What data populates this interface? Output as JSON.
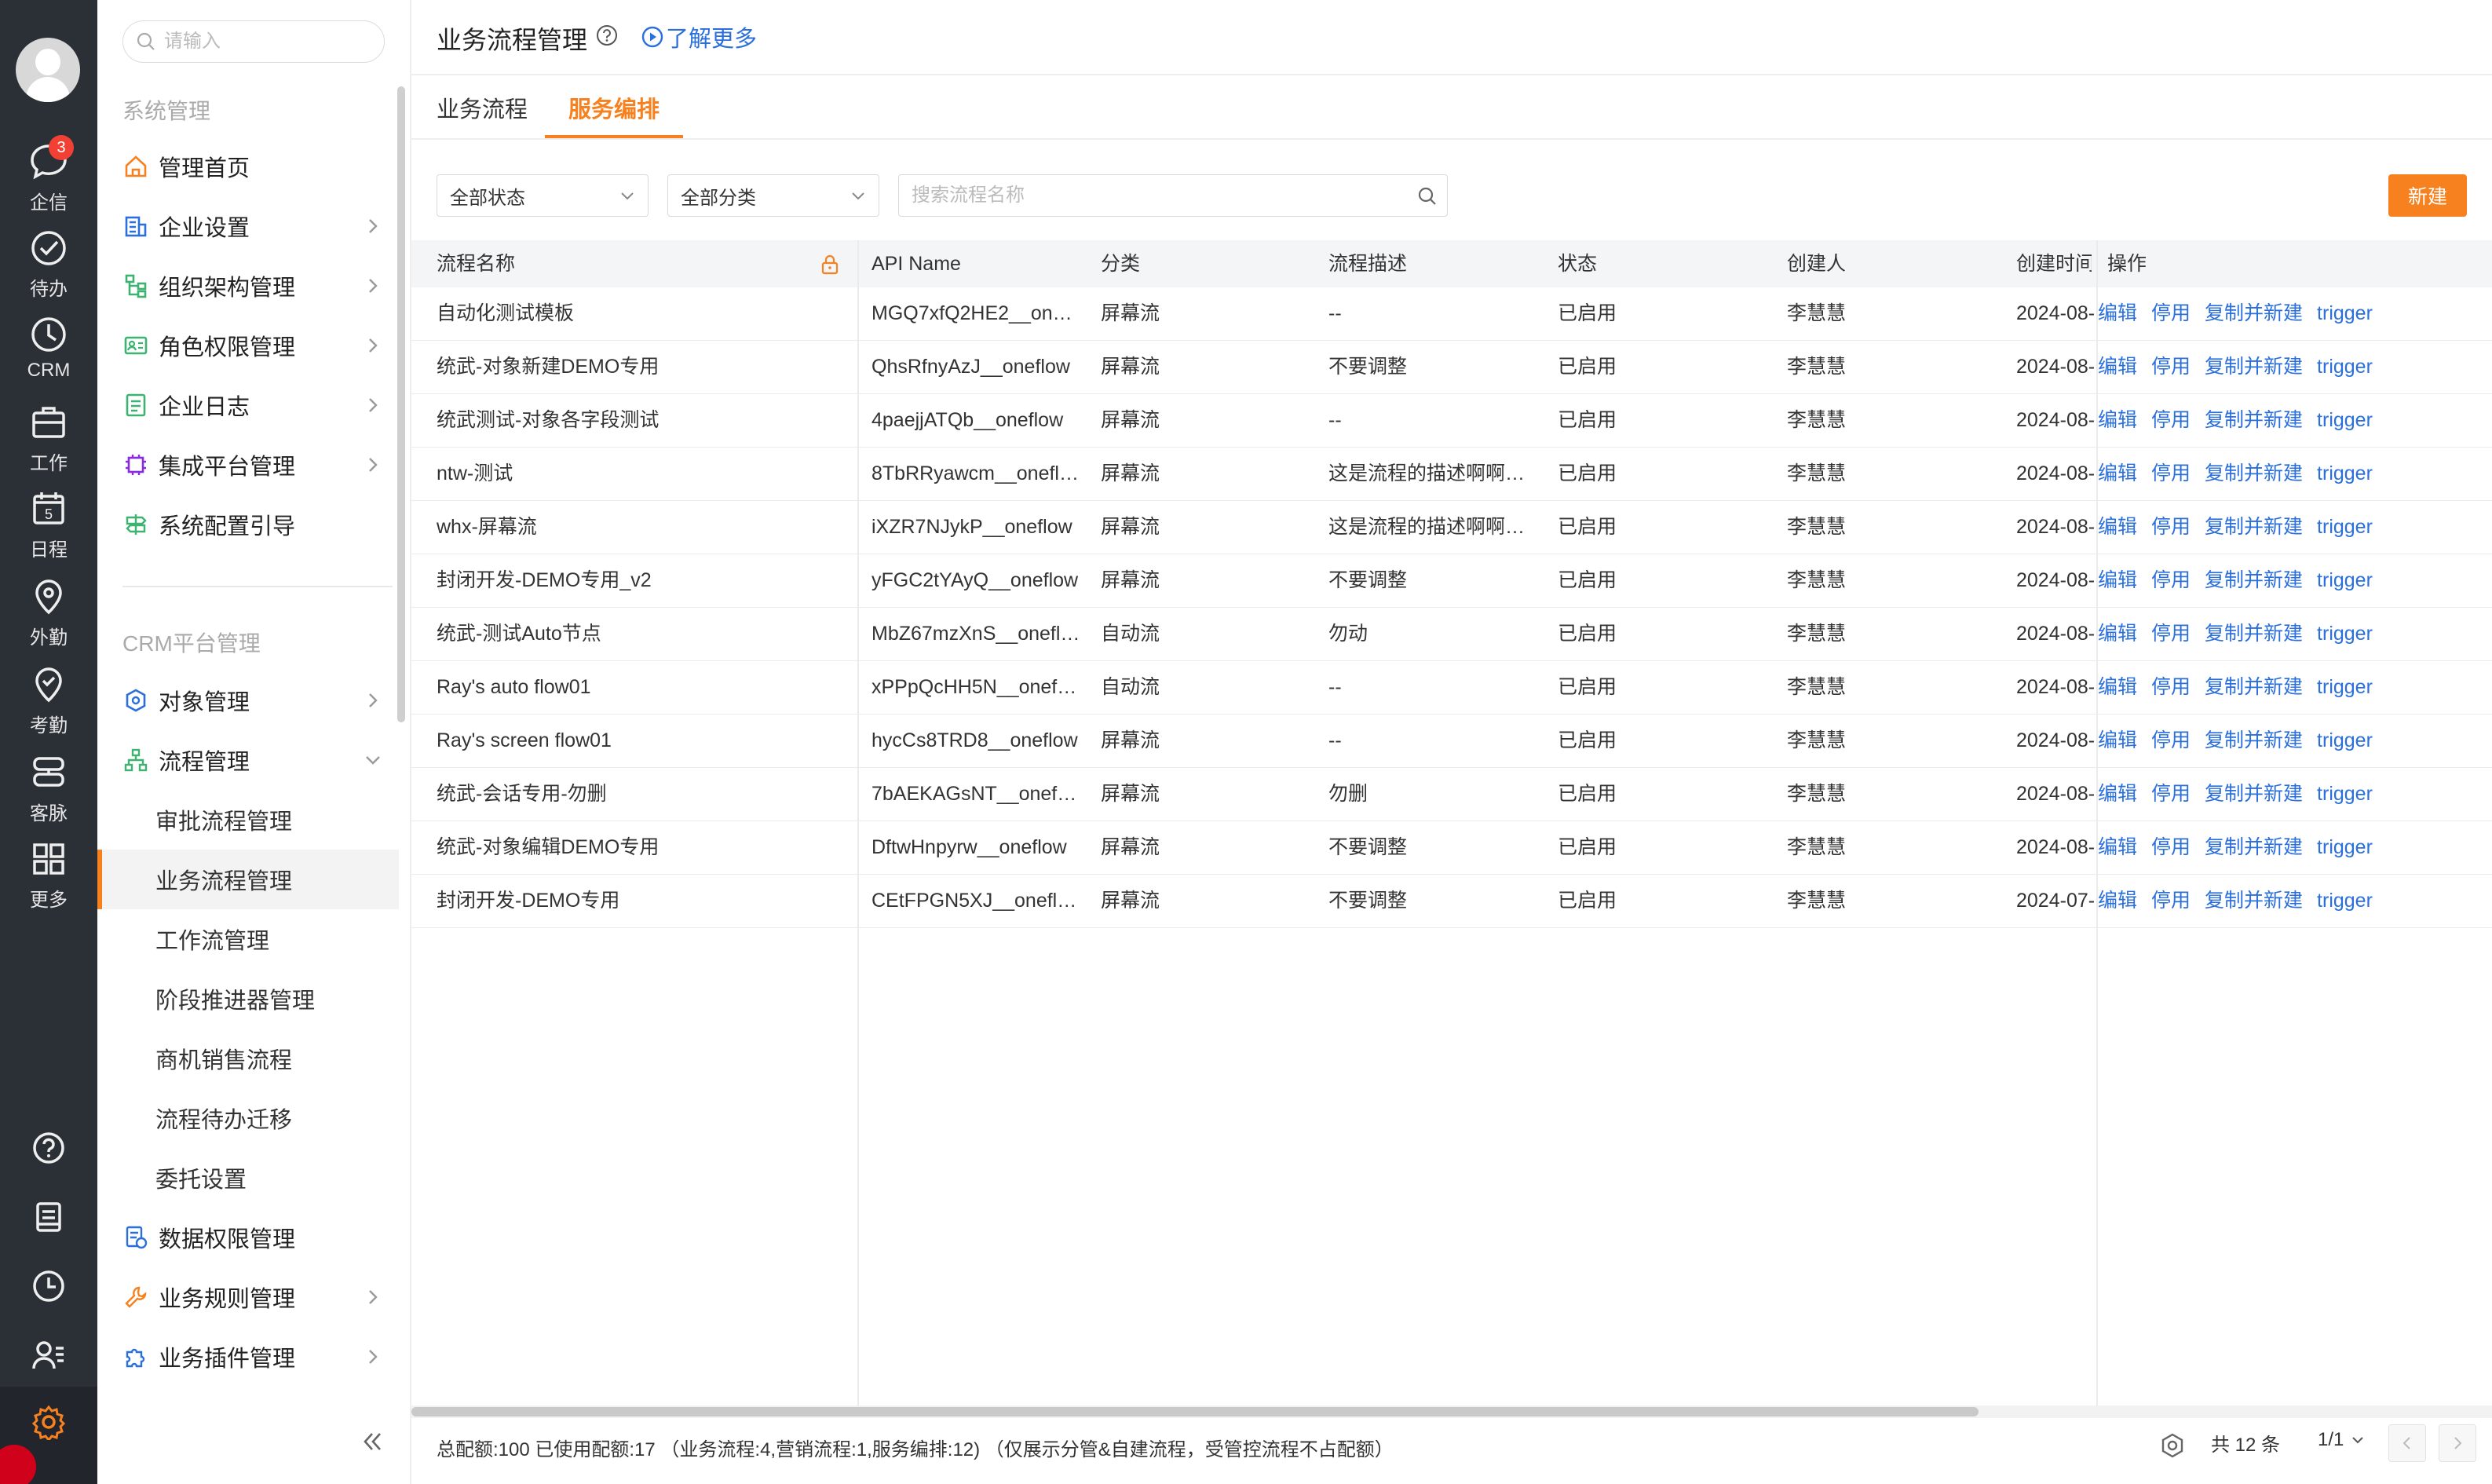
{
  "rail": {
    "items": [
      {
        "label": "企信",
        "icon": "chat-icon",
        "badge": "3"
      },
      {
        "label": "待办",
        "icon": "check-circle-icon"
      },
      {
        "label": "CRM",
        "icon": "clock-icon"
      },
      {
        "label": "工作",
        "icon": "briefcase-icon"
      },
      {
        "label": "日程",
        "icon": "calendar-icon",
        "day": "5"
      },
      {
        "label": "外勤",
        "icon": "location-icon"
      },
      {
        "label": "考勤",
        "icon": "attendance-icon"
      },
      {
        "label": "客脉",
        "icon": "contacts-icon"
      },
      {
        "label": "更多",
        "icon": "grid-icon"
      }
    ]
  },
  "sidebar": {
    "search_placeholder": "请输入",
    "section1": "系统管理",
    "items1": [
      {
        "label": "管理首页"
      },
      {
        "label": "企业设置"
      },
      {
        "label": "组织架构管理"
      },
      {
        "label": "角色权限管理"
      },
      {
        "label": "企业日志"
      },
      {
        "label": "集成平台管理"
      },
      {
        "label": "系统配置引导"
      }
    ],
    "section2": "CRM平台管理",
    "items2": [
      {
        "label": "对象管理"
      },
      {
        "label": "流程管理"
      }
    ],
    "sub_items": [
      {
        "label": "审批流程管理"
      },
      {
        "label": "业务流程管理"
      },
      {
        "label": "工作流管理"
      },
      {
        "label": "阶段推进器管理"
      },
      {
        "label": "商机销售流程"
      },
      {
        "label": "流程待办迁移"
      },
      {
        "label": "委托设置"
      }
    ],
    "items3": [
      {
        "label": "数据权限管理"
      },
      {
        "label": "业务规则管理"
      },
      {
        "label": "业务插件管理"
      }
    ]
  },
  "header": {
    "title": "业务流程管理",
    "learn_more": "了解更多"
  },
  "tabs": [
    {
      "label": "业务流程"
    },
    {
      "label": "服务编排"
    }
  ],
  "filters": {
    "status": "全部状态",
    "category": "全部分类",
    "search_placeholder": "搜索流程名称",
    "new_button": "新建"
  },
  "table": {
    "columns": [
      "流程名称",
      "API Name",
      "分类",
      "流程描述",
      "状态",
      "创建人",
      "创建时间",
      "操作"
    ],
    "rows": [
      {
        "name": "自动化测试模板",
        "api": "MGQ7xfQ2HE2__on…",
        "category": "屏幕流",
        "desc": "--",
        "status": "已启用",
        "creator": "李慧慧",
        "created": "2024-08-"
      },
      {
        "name": "统武-对象新建DEMO专用",
        "api": "QhsRfnyAzJ__oneflow",
        "category": "屏幕流",
        "desc": "不要调整",
        "status": "已启用",
        "creator": "李慧慧",
        "created": "2024-08-"
      },
      {
        "name": "统武测试-对象各字段测试",
        "api": "4paejjATQb__oneflow",
        "category": "屏幕流",
        "desc": "--",
        "status": "已启用",
        "creator": "李慧慧",
        "created": "2024-08-"
      },
      {
        "name": "ntw-测试",
        "api": "8TbRRyawcm__onefl…",
        "category": "屏幕流",
        "desc": "这是流程的描述啊啊…",
        "status": "已启用",
        "creator": "李慧慧",
        "created": "2024-08-"
      },
      {
        "name": "whx-屏幕流",
        "api": "iXZR7NJykP__oneflow",
        "category": "屏幕流",
        "desc": "这是流程的描述啊啊…",
        "status": "已启用",
        "creator": "李慧慧",
        "created": "2024-08-"
      },
      {
        "name": "封闭开发-DEMO专用_v2",
        "api": "yFGC2tYAyQ__oneflow",
        "category": "屏幕流",
        "desc": "不要调整",
        "status": "已启用",
        "creator": "李慧慧",
        "created": "2024-08-"
      },
      {
        "name": "统武-测试Auto节点",
        "api": "MbZ67mzXnS__onefl…",
        "category": "自动流",
        "desc": "勿动",
        "status": "已启用",
        "creator": "李慧慧",
        "created": "2024-08-"
      },
      {
        "name": "Ray's auto flow01",
        "api": "xPPpQcHH5N__onef…",
        "category": "自动流",
        "desc": "--",
        "status": "已启用",
        "creator": "李慧慧",
        "created": "2024-08-"
      },
      {
        "name": "Ray's screen flow01",
        "api": "hycCs8TRD8__oneflow",
        "category": "屏幕流",
        "desc": "--",
        "status": "已启用",
        "creator": "李慧慧",
        "created": "2024-08-"
      },
      {
        "name": "统武-会话专用-勿删",
        "api": "7bAEKAGsNT__onef…",
        "category": "屏幕流",
        "desc": "勿删",
        "status": "已启用",
        "creator": "李慧慧",
        "created": "2024-08-"
      },
      {
        "name": "统武-对象编辑DEMO专用",
        "api": "DftwHnpyrw__oneflow",
        "category": "屏幕流",
        "desc": "不要调整",
        "status": "已启用",
        "creator": "李慧慧",
        "created": "2024-08-"
      },
      {
        "name": "封闭开发-DEMO专用",
        "api": "CEtFPGN5XJ__onefl…",
        "category": "屏幕流",
        "desc": "不要调整",
        "status": "已启用",
        "creator": "李慧慧",
        "created": "2024-07-"
      }
    ],
    "ops": [
      "编辑",
      "停用",
      "复制并新建",
      "trigger"
    ]
  },
  "footer": {
    "note": "总配额:100 已使用配额:17 （业务流程:4,营销流程:1,服务编排:12) （仅展示分管&自建流程，受管控流程不占配额）",
    "total": "共 12 条",
    "page": "1/1"
  },
  "colors": {
    "accent": "#f7811e",
    "link": "#2a6fdb",
    "rail": "#2b2f36",
    "badge": "#f04134"
  }
}
